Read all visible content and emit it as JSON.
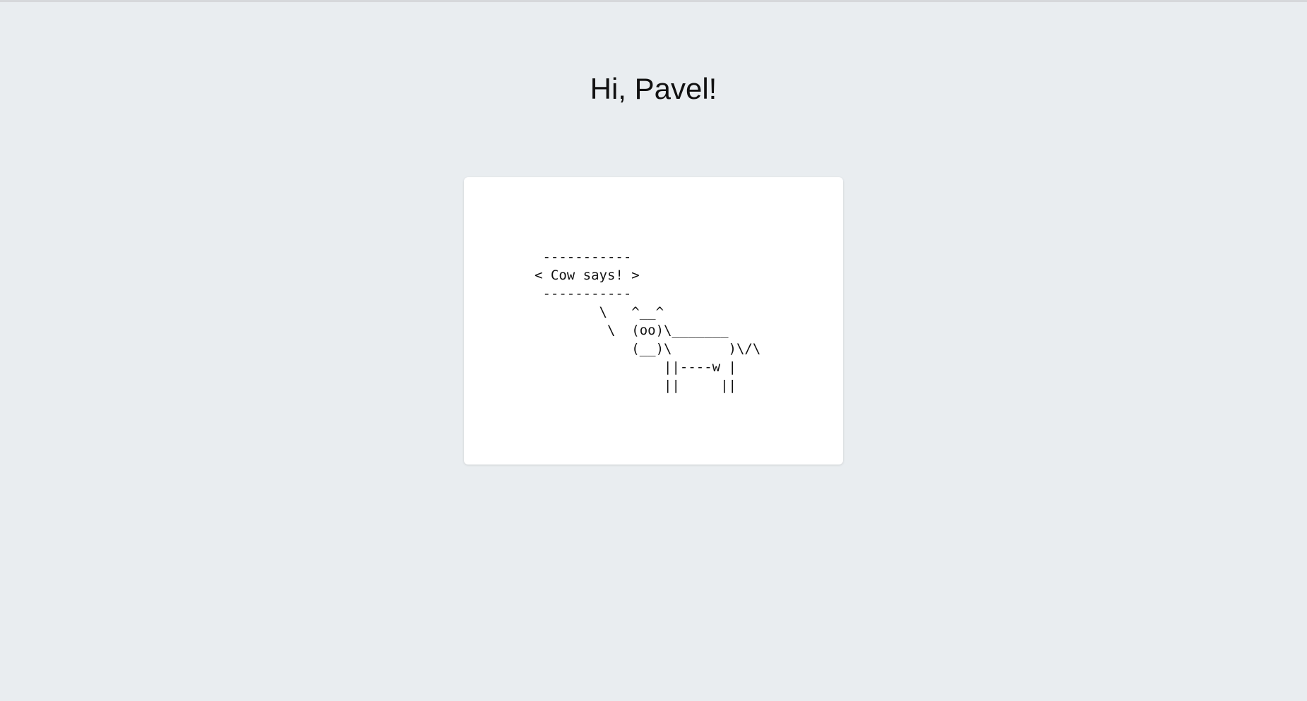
{
  "page": {
    "greeting": "Hi, Pavel!"
  },
  "card": {
    "cow_art": " -----------\n< Cow says! >\n -----------\n        \\   ^__^\n         \\  (oo)\\_______\n            (__)\\       )\\/\\\n                ||----w |\n                ||     ||"
  },
  "colors": {
    "background": "#e9edf0",
    "card": "#ffffff",
    "text": "#111111"
  }
}
